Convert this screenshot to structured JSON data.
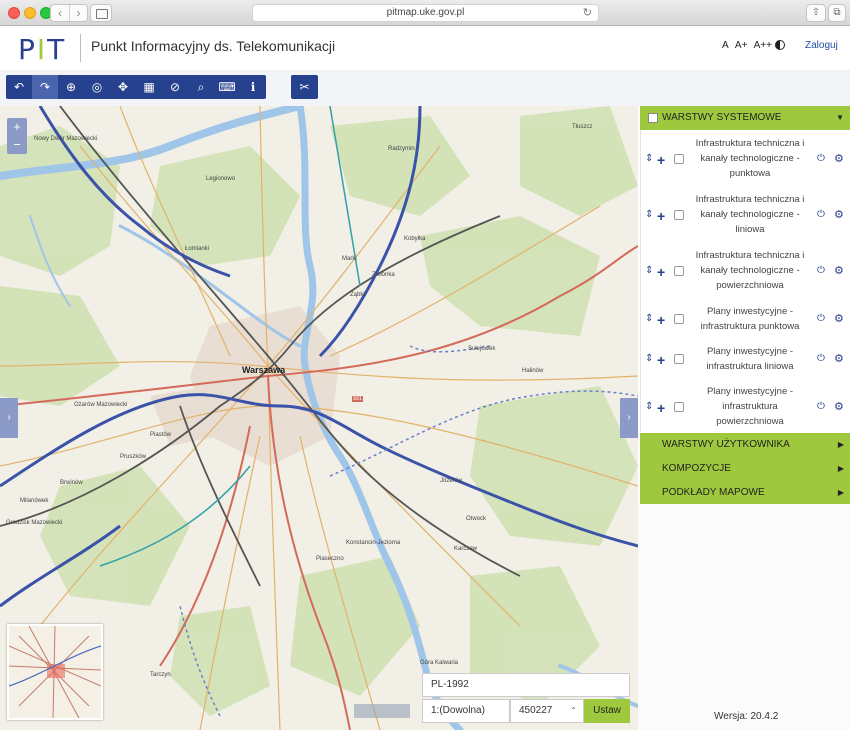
{
  "browser": {
    "url": "pitmap.uke.gov.pl",
    "back_icon": "chevron-left-icon",
    "forward_icon": "chevron-right-icon"
  },
  "header": {
    "logo_p": "P",
    "logo_i": "I",
    "logo_t": "T",
    "title": "Punkt Informacyjny ds. Telekomunikacji",
    "font_small": "A",
    "font_medium": "A+",
    "font_large": "A++",
    "login": "Zaloguj"
  },
  "toolbar": {
    "tools": [
      {
        "icon": "undo-icon",
        "glyph": "↶"
      },
      {
        "icon": "redo-icon",
        "glyph": "↷"
      },
      {
        "icon": "crosshair-icon",
        "glyph": "⊕"
      },
      {
        "icon": "target-icon",
        "glyph": "◎"
      },
      {
        "icon": "move-icon",
        "glyph": "✥"
      },
      {
        "icon": "map-icon",
        "glyph": "▦"
      },
      {
        "icon": "compass-icon",
        "glyph": "⊘"
      },
      {
        "icon": "search-icon",
        "glyph": "⌕"
      },
      {
        "icon": "keyboard-icon",
        "glyph": "⌨"
      },
      {
        "icon": "info-icon",
        "glyph": "ℹ"
      }
    ],
    "extra_icon": "tools-icon",
    "extra_glyph": "✂"
  },
  "map": {
    "zoom_in": "+",
    "zoom_out": "−",
    "left_toggle": "›",
    "right_toggle": "›",
    "city_label": "Warszawa",
    "labels": [
      "Nowy Dwór Mazowiecki",
      "Legionowo",
      "Radzymin",
      "Łomianki",
      "Marki",
      "Kobyłka",
      "Ząbki",
      "Zielonka",
      "Sulejówek",
      "Halinów",
      "Ożarów Mazowiecki",
      "Piastów",
      "Pruszków",
      "Józefów",
      "Otwock",
      "Konstancin-Jeziorna",
      "Piaseczno",
      "Karczew",
      "Góra Kalwaria",
      "Tarczyn",
      "Brwinów",
      "Milanówek",
      "Tłuszcz",
      "Grodzisk Mazowiecki"
    ],
    "road_number": "S61",
    "projection": "PL-1992",
    "scale_select": "1:(Dowolna)",
    "scale_value": "450227",
    "set_button": "Ustaw"
  },
  "panel": {
    "system_layers_title": "WARSTWY SYSTEMOWE",
    "layers": [
      {
        "name": "Infrastruktura techniczna i kanały technologiczne - punktowa"
      },
      {
        "name": "Infrastruktura techniczna i kanały technologiczne - liniowa"
      },
      {
        "name": "Infrastruktura techniczna i kanały technologiczne - powierzchniowa"
      },
      {
        "name": "Plany inwestycyjne - infrastruktura punktowa"
      },
      {
        "name": "Plany inwestycyjne - infrastruktura liniowa"
      },
      {
        "name": "Plany inwestycyjne - infrastruktura powierzchniowa"
      }
    ],
    "user_layers": "WARSTWY UŻYTKOWNIKA",
    "compositions": "KOMPOZYCJE",
    "base_maps": "PODKŁADY MAPOWE",
    "version": "Wersja: 20.4.2"
  },
  "colors": {
    "brand_blue": "#26418e",
    "brand_green": "#9ec93e",
    "map_blue_tint": "#8b9ac6"
  }
}
